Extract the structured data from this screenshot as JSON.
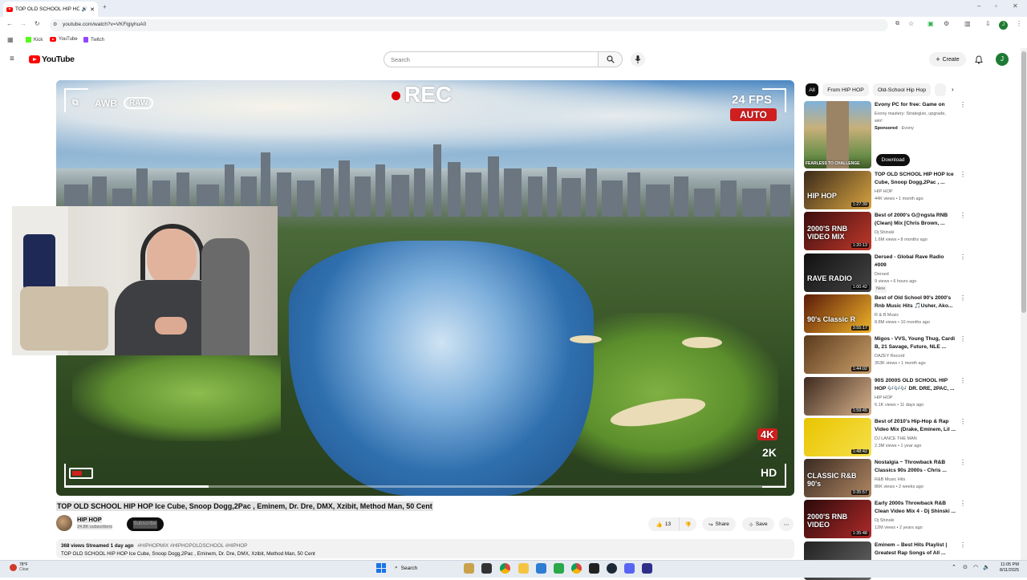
{
  "browser": {
    "tab_title": "TOP OLD SCHOOL HIP HOP",
    "url": "youtube.com/watch?v=VKFlgiyhuA0",
    "bookmarks": [
      {
        "label": "Kick"
      },
      {
        "label": "YouTube"
      },
      {
        "label": "Twitch"
      }
    ],
    "profile_initial": "J"
  },
  "header": {
    "logo_text": "YouTube",
    "search_placeholder": "Search",
    "create_label": "Create",
    "avatar_initial": "J"
  },
  "player": {
    "overlay": {
      "awb": "AWB",
      "raw": "RAW",
      "rec": "REC",
      "fps": "24 FPS",
      "auto": "AUTO",
      "res_4k": "4K",
      "res_2k": "2K",
      "res_hd": "HD"
    }
  },
  "video": {
    "title": "TOP OLD SCHOOL HIP HOP Ice Cube, Snoop Dogg,2Pac , Eminem, Dr. Dre, DMX, Xzibit, Method Man, 50 Cent",
    "channel_name": "HIP HOP",
    "subscribers": "24.8K subscribers",
    "subscribe_label": "Subscribe",
    "likes": "13",
    "share_label": "Share",
    "save_label": "Save",
    "description_meta": "368 views  Streamed 1 day ago",
    "description_tags": "#HIPHOPMIX #HIPHOPOLDSCHOOL #HIPHOP",
    "description_text": "TOP OLD SCHOOL HIP HOP Ice Cube, Snoop Dogg,2Pac , Eminem, Dr. Dre, DMX, Xzibit, Method Man, 50 Cent"
  },
  "sidebar": {
    "chips": [
      "All",
      "From HIP HOP",
      "Old-School Hip Hop"
    ],
    "ad": {
      "title": "Evony PC for free: Game on",
      "description": "Evony mastery: Strategize, upgrade, win!",
      "sponsored": "Sponsored",
      "advertiser": "Evony",
      "cta": "Download",
      "thumb_caption": "FEARLESS TO CHALLENGE"
    },
    "videos": [
      {
        "title": "TOP OLD SCHOOL HIP HOP Ice Cube, Snoop Dogg,2Pac , ...",
        "channel": "HIP HOP",
        "meta": "44K views • 1 month ago",
        "duration": "1:27:39",
        "thumb_text": "HIP HOP",
        "colors": [
          "#3a2a1a",
          "#d9a441"
        ]
      },
      {
        "title": "Best of 2000's G@ngsta RNB (Clean) Mix [Chris Brown, ...",
        "channel": "Dj Shinski",
        "meta": "1.6M views • 8 months ago",
        "duration": "1:20:13",
        "thumb_text": "2000'S RNB VIDEO MIX",
        "colors": [
          "#3b0d0d",
          "#c0392b"
        ]
      },
      {
        "title": "Dersed - Global Rave Radio #009",
        "channel": "Dersed",
        "meta": "9 views • 6 hours ago",
        "badge": "New",
        "duration": "1:00:42",
        "thumb_text": "RAVE RADIO",
        "colors": [
          "#111111",
          "#444444"
        ]
      },
      {
        "title": "Best of Old School 90's 2000's Rnb Music Hits 🎵Usher, Ako...",
        "channel": "R & B Music",
        "meta": "8.8M views • 10 months ago",
        "duration": "3:55:17",
        "thumb_text": "90's Classic R",
        "colors": [
          "#5a1a0a",
          "#f0b429"
        ]
      },
      {
        "title": "Migos - VVS, Young Thug, Cardi B, 21 Savage, Future, NLE ...",
        "channel": "DAZEY Record",
        "meta": "353K views • 1 month ago",
        "duration": "1:44:02",
        "thumb_text": "",
        "colors": [
          "#5b3a1c",
          "#caa06b"
        ]
      },
      {
        "title": "90S 2000S OLD SCHOOL HIP HOP 🎶🎶🎶 DR. DRE, 2PAC, ...",
        "channel": "HIP HOP",
        "meta": "6.1K views • 11 days ago",
        "duration": "1:59:45",
        "thumb_text": "",
        "colors": [
          "#3d2a1f",
          "#d9b38c"
        ]
      },
      {
        "title": "Best of 2010's Hip-Hop & Rap Video Mix (Drake, Eminem, Lil ...",
        "channel": "DJ LANCE THE MAN",
        "meta": "2.3M views • 1 year ago",
        "duration": "1:48:42",
        "thumb_text": "",
        "colors": [
          "#e8c400",
          "#f7e04a"
        ]
      },
      {
        "title": "Nostalgia ~ Throwback R&B Classics 90s 2000s - Chris ...",
        "channel": "R&B Music Hits",
        "meta": "86K views • 2 weeks ago",
        "duration": "3:35:57",
        "thumb_text": "CLASSIC R&B 90's",
        "colors": [
          "#3a2a22",
          "#b08763"
        ]
      },
      {
        "title": "Early 2000s Throwback R&B Clean Video Mix 4 - Dj Shinski ...",
        "channel": "Dj Shinski",
        "meta": "12M views • 2 years ago",
        "duration": "1:35:48",
        "thumb_text": "2000'S RNB VIDEO",
        "colors": [
          "#2b0a0a",
          "#b02a2a"
        ]
      },
      {
        "title": "Eminem – Best Hits Playlist | Greatest Rap Songs of All ...",
        "channel": "",
        "meta": "",
        "duration": "",
        "thumb_text": "",
        "colors": [
          "#222222",
          "#666666"
        ]
      }
    ]
  },
  "taskbar": {
    "weather_temp": "78°F",
    "weather_desc": "Clear",
    "search_label": "Search",
    "time": "11:05 PM",
    "date": "8/11/2025"
  }
}
